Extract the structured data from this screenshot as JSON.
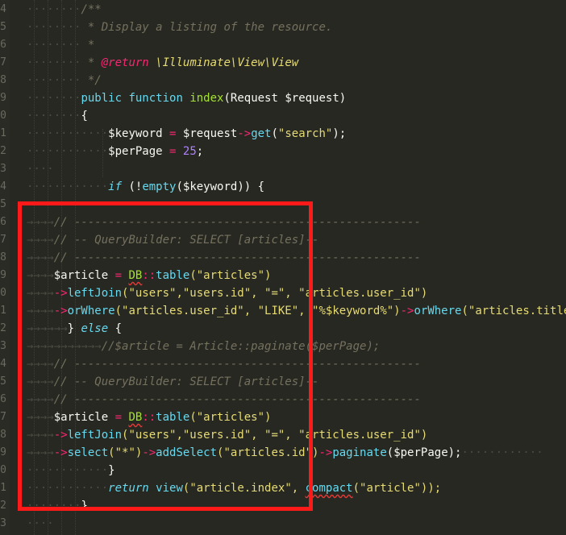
{
  "editor": {
    "line_numbers": [
      "4",
      "5",
      "6",
      "7",
      "8",
      "9",
      "0",
      "1",
      "2",
      "3",
      "4",
      "5",
      "6",
      "7",
      "8",
      "9",
      "0",
      "1",
      "2",
      "3",
      "4",
      "5",
      "6",
      "7",
      "8",
      "9",
      "0",
      "1",
      "2",
      "3"
    ],
    "code": {
      "doc_open": "/**",
      "doc_desc": " * Display a listing of the resource.",
      "doc_star": " *",
      "doc_return_star": " * ",
      "doc_return_tag": "@return",
      "doc_return_type": " \\Illuminate\\View\\View",
      "doc_close": " */",
      "sig_public": "public",
      "sig_function": "function",
      "sig_name": "index",
      "sig_params": "(Request $request)",
      "brace_open": "{",
      "kw_var": "$keyword",
      "kw_eq": " = ",
      "kw_req": "$request",
      "kw_arrow": "->",
      "kw_get": "get",
      "kw_arg_open": "(",
      "kw_arg": "\"search\"",
      "kw_end": ");",
      "pp_var": "$perPage",
      "pp_eq": " = ",
      "pp_num": "25",
      "pp_end": ";",
      "if_kw": "if",
      "if_rest_a": " (!",
      "if_empty": "empty",
      "if_rest_b": "($keyword)) {",
      "c1": "// ---------------------------------------------------",
      "c2": "// -- QueryBuilder: SELECT [articles]--",
      "c3": "// ---------------------------------------------------",
      "a1_var": "$article",
      "a1_eq": " = ",
      "a1_db": "DB",
      "a1_sep": "::",
      "a1_table": "table",
      "a1_args": "(\"articles\")",
      "lj_arrow": "->",
      "lj_fn": "leftJoin",
      "lj_args": "(\"users\",\"users.id\", \"=\", \"articles.user_id\")",
      "ow_arrow": "->",
      "ow_fn": "orWhere",
      "ow_args": "(\"articles.user_id\", \"LIKE\", \"%$keyword%\")",
      "ow_arrow2": "->",
      "ow_fn2": "orWhere",
      "ow_args2": "(\"articles.title",
      "else_open": "} ",
      "else_kw": "else",
      "else_brace": " {",
      "cm_paginate": "//$article = Article::paginate($perPage);",
      "c4": "// ---------------------------------------------------",
      "c5": "// -- QueryBuilder: SELECT [articles]--",
      "c6": "// ---------------------------------------------------",
      "a2_var": "$article",
      "a2_eq": " = ",
      "a2_db": "DB",
      "a2_sep": "::",
      "a2_table": "table",
      "a2_args": "(\"articles\")",
      "lj2_arrow": "->",
      "lj2_fn": "leftJoin",
      "lj2_args": "(\"users\",\"users.id\", \"=\", \"articles.user_id\")",
      "sel_arrow": "->",
      "sel_fn": "select",
      "sel_args": "(\"*\")",
      "as_arrow": "->",
      "as_fn": "addSelect",
      "as_args": "(\"articles.id\")",
      "pg_arrow": "->",
      "pg_fn": "paginate",
      "pg_args": "($perPage);",
      "close_if": "}",
      "ret_kw": "return",
      "ret_sp": " ",
      "ret_view": "view",
      "ret_view_args": "(\"article.index\", ",
      "ret_compact": "compact",
      "ret_compact_args": "(\"article\"));",
      "brace_close": "}"
    }
  },
  "colors": {
    "background": "#272822",
    "comment": "#75715e",
    "keyword": "#66d9ef",
    "string": "#e6db74",
    "operator": "#f92672",
    "number": "#ae81ff",
    "highlight": "#ff1a1a"
  }
}
